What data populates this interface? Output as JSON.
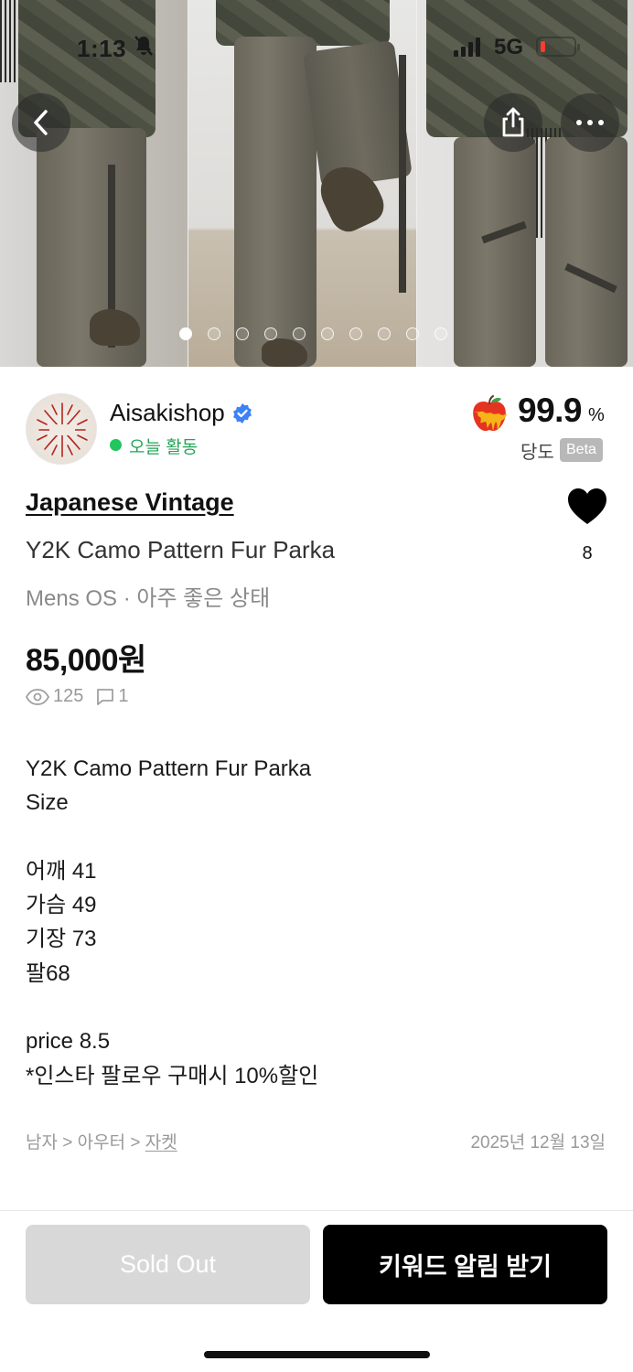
{
  "status_bar": {
    "time": "1:13",
    "network": "5G"
  },
  "hero": {
    "photo_count": 10,
    "active_index": 0
  },
  "icons": {
    "back": "back-arrow-icon",
    "share": "share-icon",
    "more": "more-icon",
    "verified": "verified-badge-icon",
    "trust": "apple-icon",
    "like": "heart-icon",
    "views": "eye-icon",
    "comments": "comment-icon"
  },
  "seller": {
    "name": "Aisakishop",
    "activity": "오늘 활동",
    "trust_score": "99.9",
    "trust_unit": "%",
    "trust_label": "당도",
    "trust_badge": "Beta"
  },
  "product": {
    "brand": "Japanese Vintage",
    "title": "Y2K Camo Pattern Fur Parka",
    "meta": "Mens OS · 아주 좋은 상태",
    "price": "85,000원",
    "views": "125",
    "comments": "1",
    "likes": "8",
    "description": [
      "Y2K Camo Pattern Fur Parka",
      "Size",
      "",
      "어깨 41",
      "가슴 49",
      "기장 73",
      "팔68",
      "",
      "price 8.5",
      "*인스타 팔로우 구매시 10%할인"
    ],
    "category_path": "남자 > 아우터 > ",
    "category_leaf": "자켓",
    "date": "2025년 12월 13일"
  },
  "actions": {
    "sold_out": "Sold Out",
    "keyword_alert": "키워드 알림 받기"
  },
  "colors": {
    "online": "#22c55e",
    "primary_button": "#000000",
    "disabled_button": "#d8d8d8",
    "verified": "#3b82f6",
    "battery_low": "#ff3b30"
  }
}
